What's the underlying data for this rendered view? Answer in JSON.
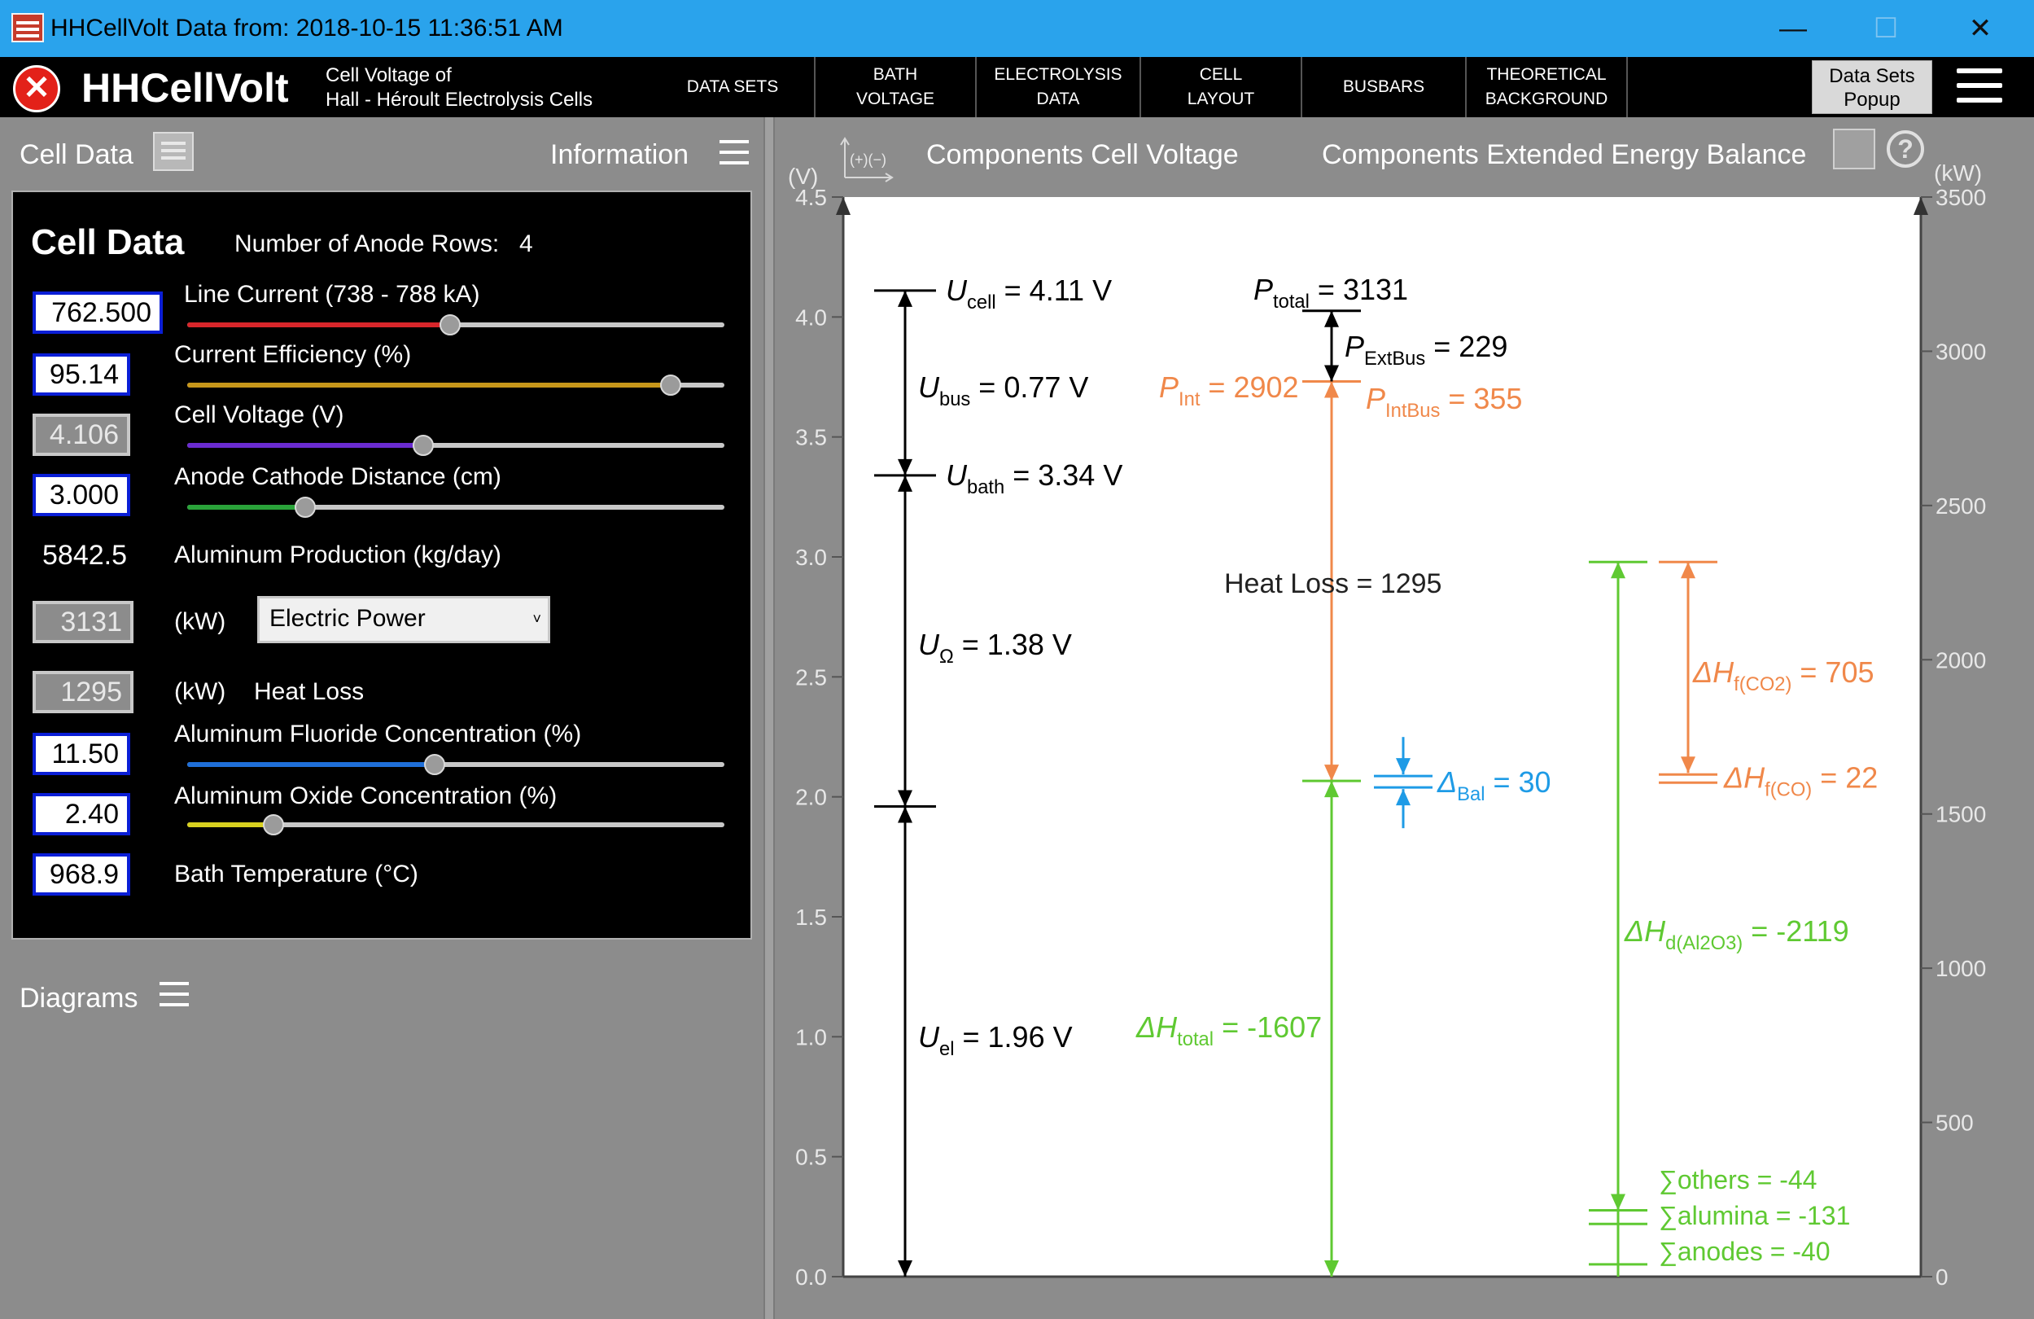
{
  "window": {
    "title": "HHCellVolt Data from: 2018-10-15 11:36:51 AM",
    "minimize": "—",
    "maximize": "☐",
    "close": "✕"
  },
  "header": {
    "brand": "HHCellVolt",
    "subtitle_line1": "Cell Voltage of",
    "subtitle_line2": "Hall - Héroult Electrolysis Cells",
    "nav": [
      {
        "l1": "DATA SETS",
        "l2": ""
      },
      {
        "l1": "BATH",
        "l2": "VOLTAGE"
      },
      {
        "l1": "ELECTROLYSIS",
        "l2": "DATA"
      },
      {
        "l1": "CELL",
        "l2": "LAYOUT"
      },
      {
        "l1": "BUSBARS",
        "l2": ""
      },
      {
        "l1": "THEORETICAL",
        "l2": "BACKGROUND"
      }
    ],
    "popup_l1": "Data Sets",
    "popup_l2": "Popup"
  },
  "left": {
    "cell_data_heading": "Cell Data",
    "information_heading": "Information",
    "diagrams_heading": "Diagrams",
    "panel": {
      "title": "Cell Data",
      "anode_rows_label": "Number of Anode Rows:",
      "anode_rows_value": "4",
      "line_current": {
        "value": "762.500",
        "label": "Line Current (738 - 788 kA)",
        "pos": 0.49,
        "color": "#d8262b"
      },
      "current_efficiency": {
        "value": "95.14",
        "label": "Current Efficiency (%)",
        "pos": 0.9,
        "color": "#c7961a"
      },
      "cell_voltage": {
        "value": "4.106",
        "label": "Cell Voltage (V)",
        "pos": 0.44,
        "color": "#6a2bd0"
      },
      "acd": {
        "value": "3.000",
        "label": "Anode Cathode Distance (cm)",
        "pos": 0.22,
        "color": "#2aa33a"
      },
      "al_production": {
        "value": "5842.5",
        "label": "Aluminum Production (kg/day)"
      },
      "power": {
        "value": "3131",
        "unit": "(kW)",
        "selected": "Electric Power"
      },
      "heat_loss": {
        "value": "1295",
        "unit": "(kW)",
        "label": "Heat Loss"
      },
      "alf3": {
        "value": "11.50",
        "label": "Aluminum Fluoride Concentration (%)",
        "pos": 0.46,
        "color": "#1f6fd8"
      },
      "al2o3": {
        "value": "2.40",
        "label": "Aluminum Oxide Concentration (%)",
        "pos": 0.16,
        "color": "#d8d01f"
      },
      "bath_temp": {
        "value": "968.9",
        "label": "Bath Temperature (°C)"
      }
    }
  },
  "right": {
    "axis_icon_label": "(+)(−)",
    "tab1": "Components Cell Voltage",
    "tab2": "Components Extended Energy Balance",
    "help": "?",
    "left_unit": "(V)",
    "right_unit": "(kW)",
    "v_ticks": [
      "0.0",
      "0.5",
      "1.0",
      "1.5",
      "2.0",
      "2.5",
      "3.0",
      "3.5",
      "4.0",
      "4.5"
    ],
    "kw_ticks": [
      "0",
      "500",
      "1000",
      "1500",
      "2000",
      "2500",
      "3000",
      "3500"
    ]
  },
  "chart_data": {
    "type": "diagram",
    "voltage": {
      "U_cell": {
        "sym": "U",
        "sub": "cell",
        "text": " = 4.11 V",
        "v": 4.11
      },
      "U_bus": {
        "sym": "U",
        "sub": "bus",
        "text": " = 0.77 V"
      },
      "U_bath": {
        "sym": "U",
        "sub": "bath",
        "text": " = 3.34 V",
        "v": 3.34
      },
      "U_ohm": {
        "sym": "U",
        "sub": "Ω",
        "text": " = 1.38 V"
      },
      "U_el": {
        "sym": "U",
        "sub": "el",
        "text": " = 1.96 V",
        "v": 1.96
      }
    },
    "power": {
      "P_total": {
        "sym": "P",
        "sub": "total",
        "text": " = 3131",
        "kw": 3131
      },
      "P_ExtBus": {
        "sym": "P",
        "sub": "ExtBus",
        "text": " = 229"
      },
      "P_Int": {
        "sym": "P",
        "sub": "Int",
        "text": " = 2902",
        "kw": 2902
      },
      "P_IntBus": {
        "sym": "P",
        "sub": "IntBus",
        "text": " = 355"
      },
      "heat_loss": {
        "text": "Heat Loss = 1295"
      },
      "dH_total": {
        "sym": "ΔH",
        "sub": "total",
        "text": " = -1607",
        "kw": 1607
      },
      "d_bal": {
        "sym": "Δ",
        "sub": "Bal",
        "text": " = 30"
      },
      "dH_f_CO2": {
        "sym": "ΔH",
        "sub": "f(CO2)",
        "text": " = 705",
        "kw": 2317
      },
      "dH_f_CO": {
        "sym": "ΔH",
        "sub": "f(CO)",
        "text": " = 22",
        "kw": 1612
      },
      "dH_d_Al2O3": {
        "sym": "ΔH",
        "sub": "d(Al2O3)",
        "text": " = -2119",
        "kw": 2317
      },
      "others": {
        "text": "∑others = -44",
        "kw": 215
      },
      "alumina": {
        "text": "∑alumina = -131",
        "kw": 171
      },
      "anodes": {
        "text": "∑anodes = -40",
        "kw": 40
      }
    },
    "ylim_left": [
      0,
      4.5
    ],
    "ylim_right": [
      0,
      3500
    ],
    "colors": {
      "voltage": "#000000",
      "power": "#f0884a",
      "green": "#5fc932",
      "blue": "#1e9be6"
    }
  }
}
